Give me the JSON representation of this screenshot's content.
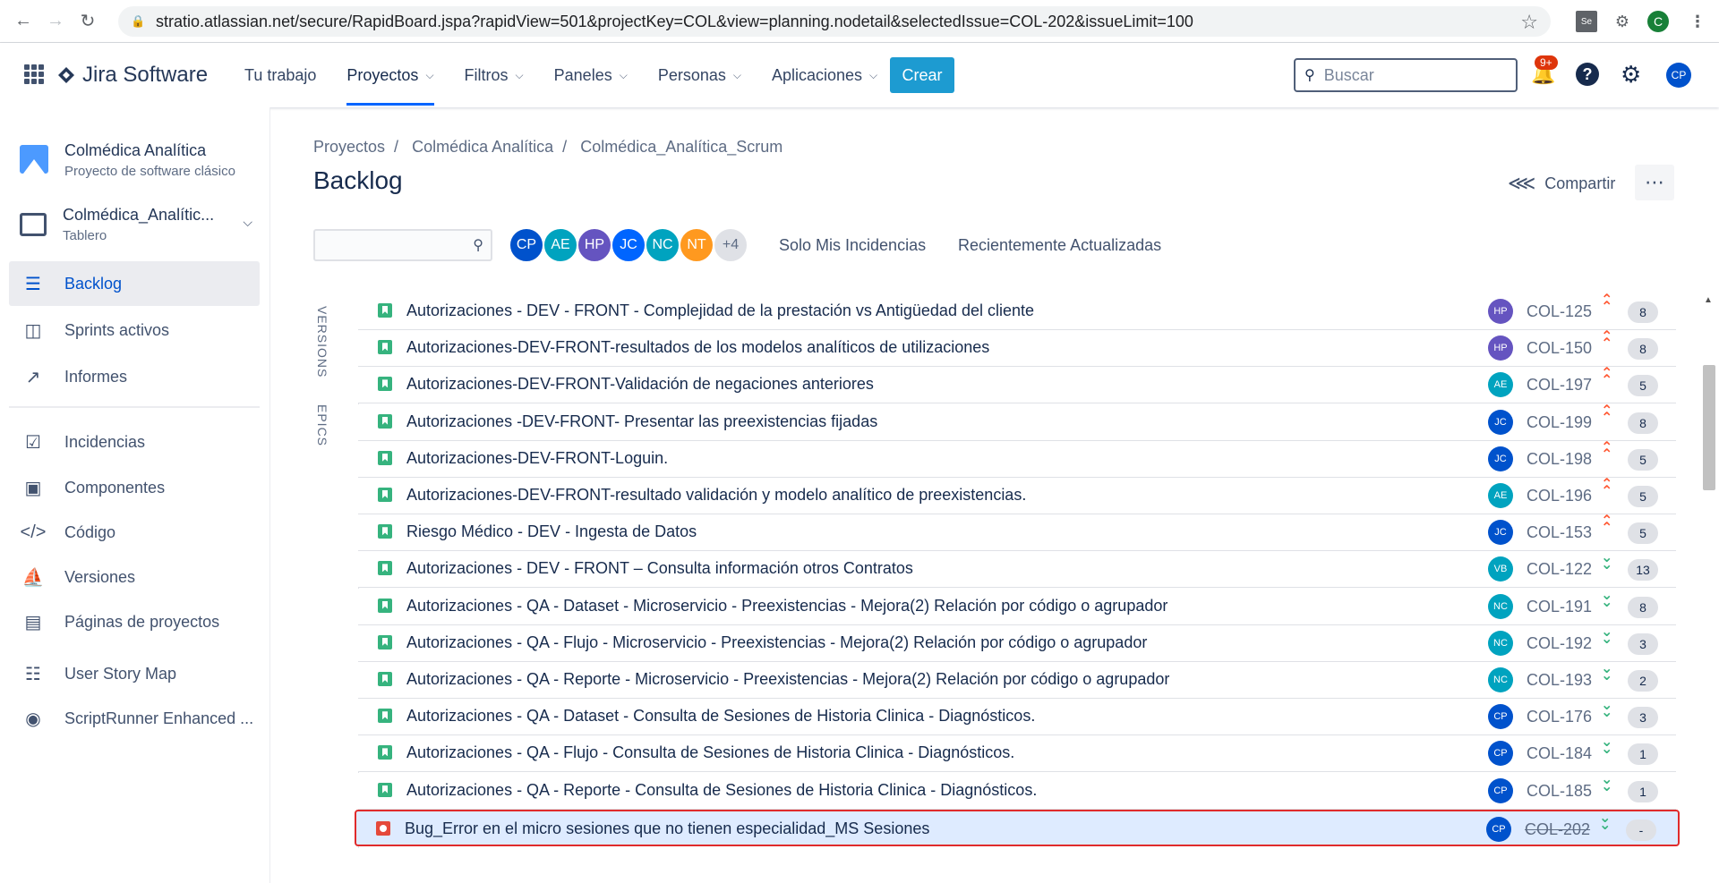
{
  "browser": {
    "url": "stratio.atlassian.net/secure/RapidBoard.jspa?rapidView=501&projectKey=COL&view=planning.nodetail&selectedIssue=COL-202&issueLimit=100",
    "profile_initial": "C",
    "ext_se_label": "Se"
  },
  "topnav": {
    "brand": "Jira Software",
    "menu": [
      {
        "label": "Tu trabajo",
        "has_chevron": false
      },
      {
        "label": "Proyectos",
        "has_chevron": true,
        "active": true
      },
      {
        "label": "Filtros",
        "has_chevron": true
      },
      {
        "label": "Paneles",
        "has_chevron": true
      },
      {
        "label": "Personas",
        "has_chevron": true
      },
      {
        "label": "Aplicaciones",
        "has_chevron": true
      }
    ],
    "create_label": "Crear",
    "search_placeholder": "Buscar",
    "notifications_badge": "9+",
    "user_initials": "CP",
    "accent": "#1d9bd1"
  },
  "sidebar": {
    "project_name": "Colmédica Analítica",
    "project_type": "Proyecto de software clásico",
    "board_name": "Colmédica_Analític...",
    "board_type": "Tablero",
    "items": [
      {
        "label": "Backlog",
        "icon": "backlog-icon",
        "active": true
      },
      {
        "label": "Sprints activos",
        "icon": "board-columns-icon"
      },
      {
        "label": "Informes",
        "icon": "chart-line-icon"
      },
      {
        "label": "Incidencias",
        "icon": "issues-icon"
      },
      {
        "label": "Componentes",
        "icon": "components-icon"
      },
      {
        "label": "Código",
        "icon": "code-icon"
      },
      {
        "label": "Versiones",
        "icon": "ship-icon"
      },
      {
        "label": "Páginas de proyectos",
        "icon": "page-icon"
      },
      {
        "label": "User Story Map",
        "icon": "story-map-icon"
      },
      {
        "label": "ScriptRunner Enhanced ...",
        "icon": "scriptrunner-icon"
      }
    ]
  },
  "main": {
    "breadcrumb": [
      "Proyectos",
      "Colmédica Analítica",
      "Colmédica_Analítica_Scrum"
    ],
    "title": "Backlog",
    "share_label": "Compartir",
    "avatars": [
      {
        "initials": "CP",
        "color": "#0052cc"
      },
      {
        "initials": "AE",
        "color": "#00a3bf"
      },
      {
        "initials": "HP",
        "color": "#6554c0"
      },
      {
        "initials": "JC",
        "color": "#0065ff"
      },
      {
        "initials": "NC",
        "color": "#00a3bf"
      },
      {
        "initials": "NT",
        "color": "#ff991f"
      }
    ],
    "avatars_more": "+4",
    "quick_filters": [
      "Solo Mis Incidencias",
      "Recientemente Actualizadas"
    ],
    "side_tabs": [
      "VERSIONS",
      "EPICS"
    ]
  },
  "issues": [
    {
      "summary": "Autorizaciones - DEV - FRONT - Complejidad de la prestación vs Antigüedad del cliente",
      "assignee": "HP",
      "color": "#6554c0",
      "key": "COL-125",
      "priority": "high",
      "estimate": "8"
    },
    {
      "summary": "Autorizaciones-DEV-FRONT-resultados de los modelos analíticos de utilizaciones",
      "assignee": "HP",
      "color": "#6554c0",
      "key": "COL-150",
      "priority": "high",
      "estimate": "8"
    },
    {
      "summary": "Autorizaciones-DEV-FRONT-Validación de negaciones anteriores",
      "assignee": "AE",
      "color": "#00a3bf",
      "key": "COL-197",
      "priority": "high",
      "estimate": "5"
    },
    {
      "summary": "Autorizaciones -DEV-FRONT- Presentar las preexistencias fijadas",
      "assignee": "JC",
      "color": "#0052cc",
      "key": "COL-199",
      "priority": "high",
      "estimate": "8"
    },
    {
      "summary": "Autorizaciones-DEV-FRONT-Loguin.",
      "assignee": "JC",
      "color": "#0052cc",
      "key": "COL-198",
      "priority": "high",
      "estimate": "5"
    },
    {
      "summary": "Autorizaciones-DEV-FRONT-resultado validación y modelo analítico de preexistencias.",
      "assignee": "AE",
      "color": "#00a3bf",
      "key": "COL-196",
      "priority": "high",
      "estimate": "5"
    },
    {
      "summary": "Riesgo Médico - DEV - Ingesta de Datos",
      "assignee": "JC",
      "color": "#0052cc",
      "key": "COL-153",
      "priority": "high",
      "estimate": "5"
    },
    {
      "summary": "Autorizaciones - DEV - FRONT – Consulta información otros Contratos",
      "assignee": "VB",
      "color": "#00a3bf",
      "key": "COL-122",
      "priority": "low",
      "estimate": "13"
    },
    {
      "summary": "Autorizaciones - QA - Dataset - Microservicio - Preexistencias - Mejora(2) Relación por código o agrupador",
      "assignee": "NC",
      "color": "#00a3bf",
      "key": "COL-191",
      "priority": "low",
      "estimate": "8"
    },
    {
      "summary": "Autorizaciones - QA - Flujo - Microservicio - Preexistencias - Mejora(2) Relación por código o agrupador",
      "assignee": "NC",
      "color": "#00a3bf",
      "key": "COL-192",
      "priority": "low",
      "estimate": "3"
    },
    {
      "summary": "Autorizaciones - QA - Reporte - Microservicio - Preexistencias - Mejora(2) Relación por código o agrupador",
      "assignee": "NC",
      "color": "#00a3bf",
      "key": "COL-193",
      "priority": "low",
      "estimate": "2"
    },
    {
      "summary": "Autorizaciones - QA - Dataset - Consulta de Sesiones de Historia Clinica - Diagnósticos.",
      "assignee": "CP",
      "color": "#0052cc",
      "key": "COL-176",
      "priority": "low",
      "estimate": "3"
    },
    {
      "summary": "Autorizaciones - QA - Flujo - Consulta de Sesiones de Historia Clinica - Diagnósticos.",
      "assignee": "CP",
      "color": "#0052cc",
      "key": "COL-184",
      "priority": "low",
      "estimate": "1"
    },
    {
      "summary": "Autorizaciones - QA - Reporte - Consulta de Sesiones de Historia Clinica - Diagnósticos.",
      "assignee": "CP",
      "color": "#0052cc",
      "key": "COL-185",
      "priority": "low",
      "estimate": "1"
    },
    {
      "summary": "Bug_Error en el micro sesiones que no tienen especialidad_MS Sesiones",
      "assignee": "CP",
      "color": "#0052cc",
      "key": "COL-202",
      "priority": "low",
      "estimate": "-",
      "type": "bug",
      "selected": true,
      "done": true
    }
  ]
}
